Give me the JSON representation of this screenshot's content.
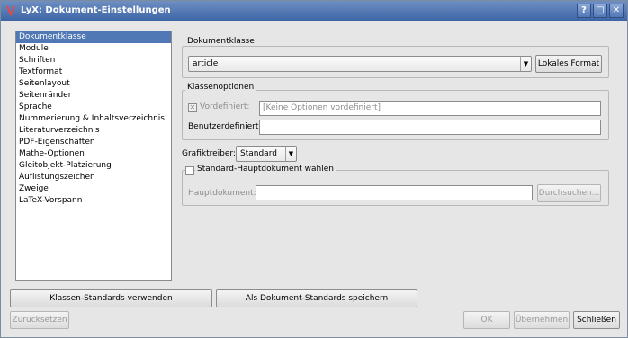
{
  "window": {
    "title": "LyX: Dokument-Einstellungen",
    "controls": {
      "help": "?",
      "maximize": "□",
      "close": "✕"
    }
  },
  "nav": {
    "items": [
      {
        "label": "Dokumentklasse",
        "selected": true
      },
      {
        "label": "Module"
      },
      {
        "label": "Schriften"
      },
      {
        "label": "Textformat"
      },
      {
        "label": "Seitenlayout"
      },
      {
        "label": "Seitenränder"
      },
      {
        "label": "Sprache"
      },
      {
        "label": "Nummerierung & Inhaltsverzeichnis"
      },
      {
        "label": "Literaturverzeichnis"
      },
      {
        "label": "PDF-Eigenschaften"
      },
      {
        "label": "Mathe-Optionen"
      },
      {
        "label": "Gleitobjekt-Platzierung"
      },
      {
        "label": "Auflistungszeichen"
      },
      {
        "label": "Zweige"
      },
      {
        "label": "LaTeX-Vorspann"
      }
    ]
  },
  "docclass": {
    "group_label": "Dokumentklasse",
    "value": "article",
    "local_format_button": "Lokales Format"
  },
  "classopts": {
    "group_label": "Klassenoptionen",
    "predefined_label": "Vordefiniert:",
    "predefined_value": "[Keine Optionen vordefiniert]",
    "custom_label": "Benutzerdefiniert:",
    "custom_value": ""
  },
  "graphics": {
    "label": "Grafiktreiber:",
    "value": "Standard"
  },
  "master": {
    "checkbox_label": "Standard-Hauptdokument wählen",
    "field_label": "Hauptdokument:",
    "field_value": "",
    "browse_button": "Durchsuchen..."
  },
  "footer": {
    "use_class_defaults": "Klassen-Standards verwenden",
    "save_as_defaults": "Als Dokument-Standards speichern",
    "reset": "Zurücksetzen",
    "ok": "OK",
    "apply": "Übernehmen",
    "close": "Schließen"
  }
}
